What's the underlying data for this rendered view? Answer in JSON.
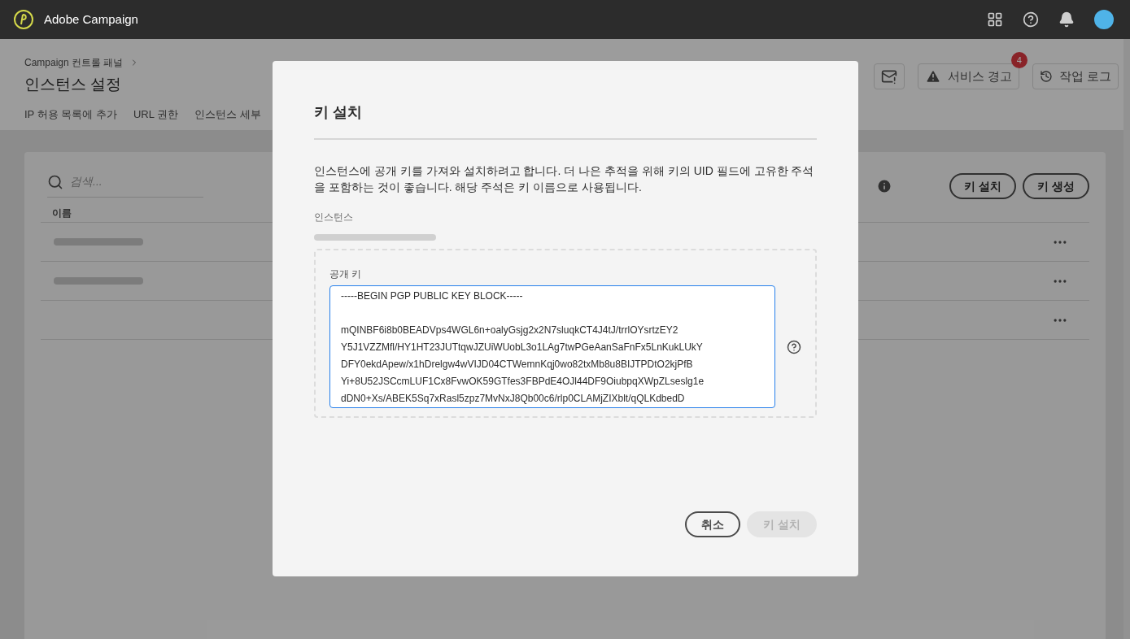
{
  "app_bar": {
    "product": "Adobe Campaign"
  },
  "page": {
    "breadcrumb": "Campaign 컨트롤 패널",
    "title": "인스턴스 설정",
    "tabs": [
      {
        "label": "IP 허용 목록에 추가",
        "selected": false
      },
      {
        "label": "URL 권한",
        "selected": false
      },
      {
        "label": "인스턴스 세부",
        "selected": false
      }
    ],
    "actions": [
      {
        "kind": "icon"
      },
      {
        "kind": "alert",
        "label": "서비스 경고",
        "badge": "4"
      },
      {
        "kind": "history",
        "label": "작업 로그"
      }
    ]
  },
  "card": {
    "search": {
      "placeholder": "검색..."
    },
    "buttons": [
      "키 설치",
      "키 생성"
    ],
    "column": "이름",
    "rows": [
      {
        "kind": "redacted"
      },
      {
        "kind": "redacted"
      },
      {
        "kind": "empty"
      }
    ]
  },
  "dialog": {
    "title": "키 설치",
    "description": "인스턴스에 공개 키를 가져와 설치하려고 합니다. 더 나은 추적을 위해 키의 UID 필드에 고유한 주석을 포함하는 것이 좋습니다. 해당 주석은 키 이름으로 사용됩니다.",
    "instance_label": "인스턴스",
    "key_label": "공개 키",
    "key_value": "-----BEGIN PGP PUBLIC KEY BLOCK-----\n\nmQINBF6i8b0BEADVps4WGL6n+oalyGsjg2x2N7sluqkCT4J4tJ/trrlOYsrtzEY2\nY5J1VZZMfl/HY1HT23JUTtqwJZUiWUobL3o1LAg7twPGeAanSaFnFx5LnKukLUkY\nDFY0ekdApew/x1hDrelgw4wVIJD04CTWemnKqj0wo82txMb8u8BIJTPDtO2kjPfB\nYi+8U52JSCcmLUF1Cx8FvwOK59GTfes3FBPdE4OJl44DF9OiubpqXWpZLseslg1e\ndDN0+Xs/ABEK5Sq7xRasl5zpz7MvNxJ8Qb00c6/rlp0CLAMjZIXblt/qQLKdbedD",
    "buttons": [
      {
        "label": "취소",
        "disabled": false
      },
      {
        "label": "키 설치",
        "disabled": true
      }
    ]
  }
}
